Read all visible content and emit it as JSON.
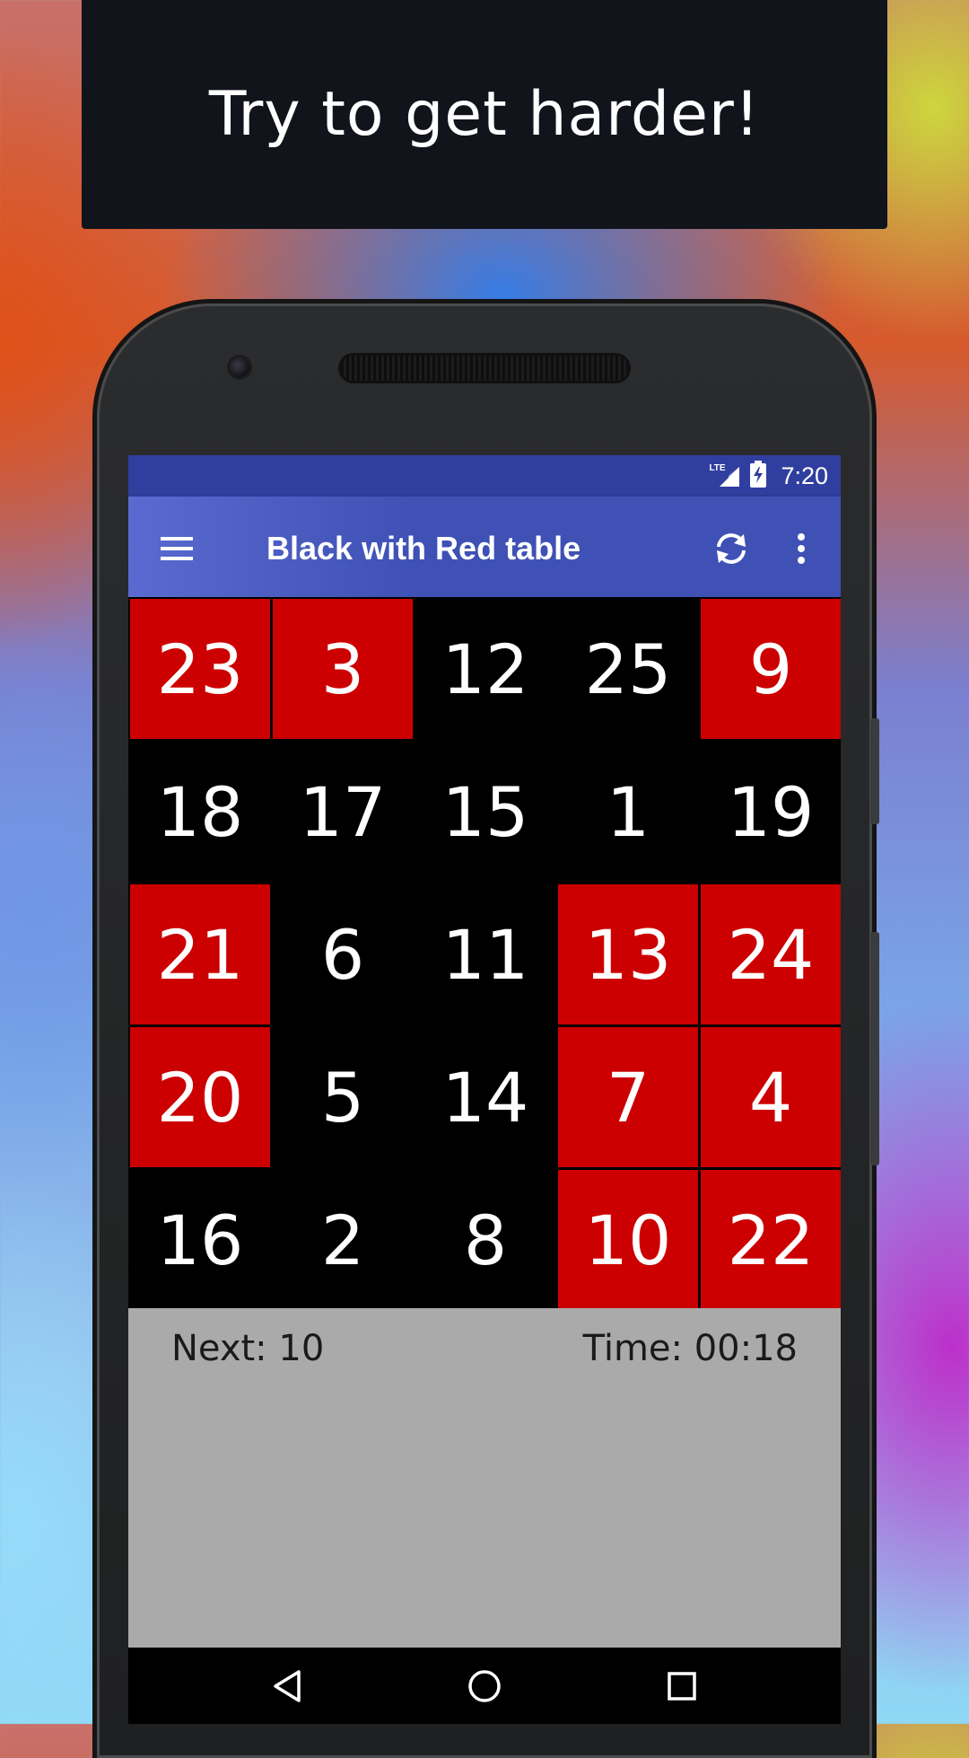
{
  "banner": {
    "text": "Try to get harder!"
  },
  "status_bar": {
    "network": "LTE",
    "time": "7:20"
  },
  "app_bar": {
    "title": "Black with Red table"
  },
  "grid": {
    "rows": [
      [
        {
          "value": "23",
          "color": "red"
        },
        {
          "value": "3",
          "color": "red"
        },
        {
          "value": "12",
          "color": "black"
        },
        {
          "value": "25",
          "color": "black"
        },
        {
          "value": "9",
          "color": "red"
        }
      ],
      [
        {
          "value": "18",
          "color": "black"
        },
        {
          "value": "17",
          "color": "black"
        },
        {
          "value": "15",
          "color": "black"
        },
        {
          "value": "1",
          "color": "black"
        },
        {
          "value": "19",
          "color": "black"
        }
      ],
      [
        {
          "value": "21",
          "color": "red"
        },
        {
          "value": "6",
          "color": "black"
        },
        {
          "value": "11",
          "color": "black"
        },
        {
          "value": "13",
          "color": "red"
        },
        {
          "value": "24",
          "color": "red"
        }
      ],
      [
        {
          "value": "20",
          "color": "red"
        },
        {
          "value": "5",
          "color": "black"
        },
        {
          "value": "14",
          "color": "black"
        },
        {
          "value": "7",
          "color": "red"
        },
        {
          "value": "4",
          "color": "red"
        }
      ],
      [
        {
          "value": "16",
          "color": "black"
        },
        {
          "value": "2",
          "color": "black"
        },
        {
          "value": "8",
          "color": "black"
        },
        {
          "value": "10",
          "color": "red"
        },
        {
          "value": "22",
          "color": "red"
        }
      ]
    ]
  },
  "info": {
    "next": "Next: 10",
    "time": "Time: 00:18"
  },
  "colors": {
    "red_cell": "#cc0000",
    "black_cell": "#000000",
    "app_bar": "#3f51b5",
    "status_bar": "#303f9f",
    "info_panel": "#aaaaaa"
  },
  "icons": {
    "menu": "hamburger-menu-icon",
    "refresh": "refresh-icon",
    "overflow": "more-vert-icon",
    "back": "nav-back-icon",
    "home": "nav-home-icon",
    "recents": "nav-recents-icon"
  }
}
